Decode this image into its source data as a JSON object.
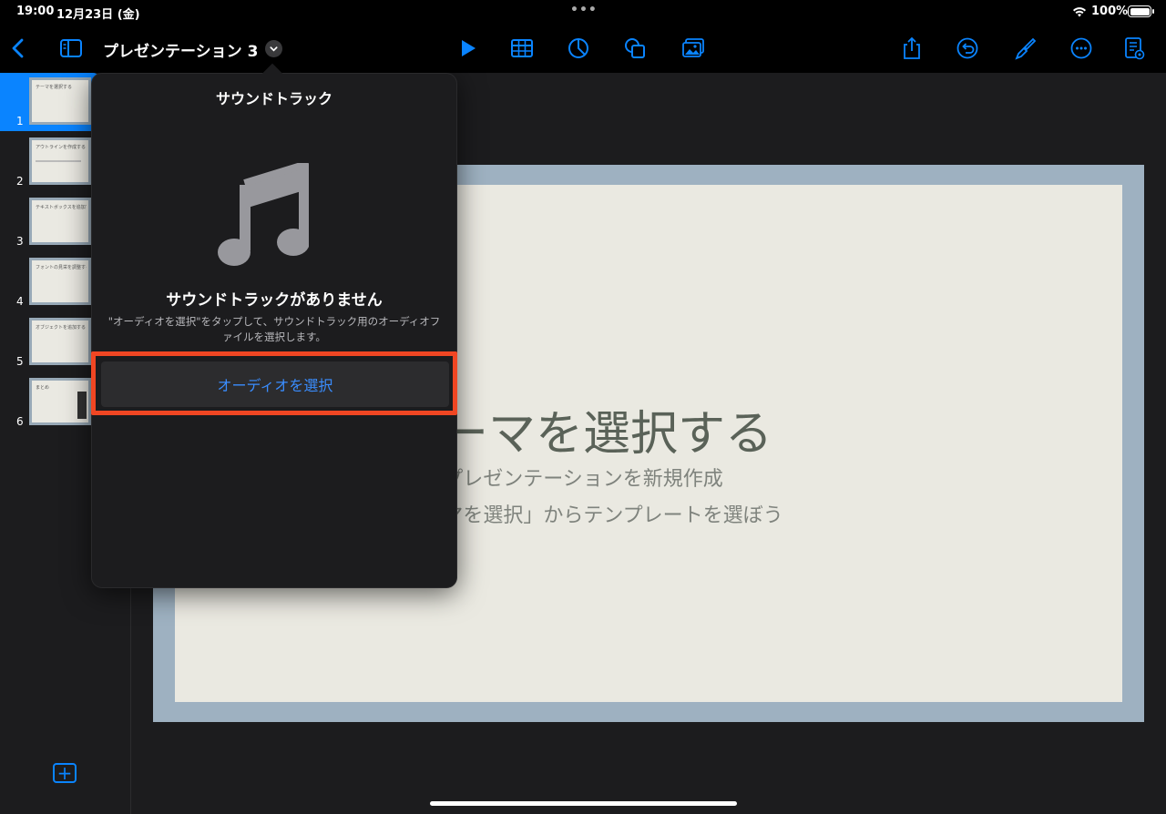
{
  "status_bar": {
    "time": "19:00",
    "date": "12月23日 (金)",
    "battery": "100%",
    "battery_level": 1.0
  },
  "toolbar": {
    "title": "プレゼンテーション 3",
    "icons": [
      "back-icon",
      "sidebar-icon",
      "chevron-down-icon",
      "play-icon",
      "table-icon",
      "chart-icon",
      "shapes-icon",
      "media-icon",
      "share-icon",
      "undo-icon",
      "format-brush-icon",
      "more-icon",
      "presenter-notes-icon"
    ],
    "accent": "#0a84ff"
  },
  "navigator": {
    "slides": [
      {
        "number": "1",
        "label": "テーマを選択する",
        "selected": true
      },
      {
        "number": "2",
        "label": "アウトラインを作成する",
        "selected": false
      },
      {
        "number": "3",
        "label": "テキストボックスを追加する",
        "selected": false
      },
      {
        "number": "4",
        "label": "フォントの見栄を調整する",
        "selected": false
      },
      {
        "number": "5",
        "label": "オブジェクトを追加する",
        "selected": false
      },
      {
        "number": "6",
        "label": "まとめ",
        "selected": false
      }
    ],
    "add_icon": "plus-square-icon"
  },
  "slide": {
    "title": "テーマを選択する",
    "subtitle_1": "プレゼンテーションを新規作成",
    "subtitle_2": "「テーマを選択」からテンプレートを選ぼう"
  },
  "popover": {
    "title": "サウンドトラック",
    "icon": "music-note-icon",
    "empty_title": "サウンドトラックがありません",
    "empty_description": "\"オーディオを選択\"をタップして、サウンドトラック用のオーディオファイルを選択します。",
    "choose_button": "オーディオを選択",
    "highlight_color": "#f04623"
  }
}
